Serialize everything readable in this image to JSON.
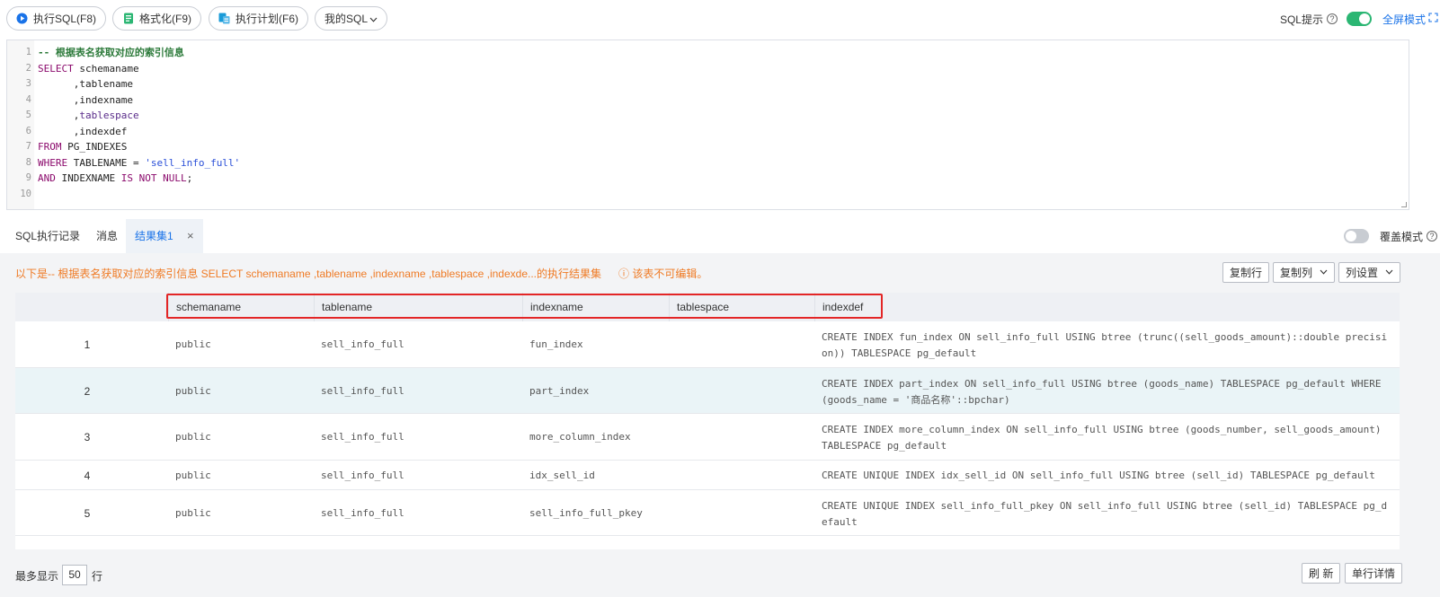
{
  "toolbar": {
    "run_label": "执行SQL(F8)",
    "format_label": "格式化(F9)",
    "plan_label": "执行计划(F6)",
    "mysql_label": "我的SQL",
    "sql_hint_label": "SQL提示",
    "fullscreen_label": "全屏模式",
    "sql_hint_on": true
  },
  "editor": {
    "lines": [
      {
        "n": "1",
        "parts": [
          [
            "cm",
            "-- 根据表名获取对应的索引信息"
          ]
        ]
      },
      {
        "n": "2",
        "parts": [
          [
            "kw",
            "SELECT"
          ],
          [
            "id",
            " schemaname"
          ]
        ]
      },
      {
        "n": "3",
        "parts": [
          [
            "id",
            "      ,tablename"
          ]
        ]
      },
      {
        "n": "4",
        "parts": [
          [
            "id",
            "      ,indexname"
          ]
        ]
      },
      {
        "n": "5",
        "parts": [
          [
            "id",
            "      ,"
          ],
          [
            "tsp",
            "tablespace"
          ]
        ]
      },
      {
        "n": "6",
        "parts": [
          [
            "id",
            "      ,indexdef"
          ]
        ]
      },
      {
        "n": "7",
        "parts": [
          [
            "kw",
            "FROM"
          ],
          [
            "id",
            " PG_INDEXES"
          ]
        ]
      },
      {
        "n": "8",
        "parts": [
          [
            "kw",
            "WHERE"
          ],
          [
            "id",
            " TABLENAME = "
          ],
          [
            "str",
            "'sell_info_full'"
          ]
        ]
      },
      {
        "n": "9",
        "parts": [
          [
            "kw",
            "AND"
          ],
          [
            "id",
            " INDEXNAME "
          ],
          [
            "kw",
            "IS NOT NULL"
          ],
          [
            "id",
            ";"
          ]
        ]
      },
      {
        "n": "10",
        "parts": []
      }
    ]
  },
  "tabs": {
    "history": "SQL执行记录",
    "messages": "消息",
    "result1": "结果集1",
    "close": "×",
    "cover_mode_label": "覆盖模式"
  },
  "result": {
    "info": "以下是-- 根据表名获取对应的索引信息 SELECT schemaname ,tablename ,indexname ,tablespace ,indexde...的执行结果集",
    "readonly_note": "ⓘ 该表不可编辑。",
    "copy_row": "复制行",
    "copy_col": "复制列",
    "col_settings": "列设置",
    "columns": [
      "schemaname",
      "tablename",
      "indexname",
      "tablespace",
      "indexdef"
    ],
    "rows": [
      {
        "num": "1",
        "schemaname": "public",
        "tablename": "sell_info_full",
        "indexname": "fun_index",
        "tablespace": "",
        "indexdef": "CREATE INDEX fun_index ON sell_info_full USING btree (trunc((sell_goods_amount)::double precisi\non)) TABLESPACE pg_default"
      },
      {
        "num": "2",
        "schemaname": "public",
        "tablename": "sell_info_full",
        "indexname": "part_index",
        "tablespace": "",
        "indexdef": "CREATE INDEX part_index ON sell_info_full USING btree (goods_name) TABLESPACE pg_default WHERE\n(goods_name = '商品名称'::bpchar)"
      },
      {
        "num": "3",
        "schemaname": "public",
        "tablename": "sell_info_full",
        "indexname": "more_column_index",
        "tablespace": "",
        "indexdef": "CREATE INDEX more_column_index ON sell_info_full USING btree (goods_number, sell_goods_amount)\nTABLESPACE pg_default"
      },
      {
        "num": "4",
        "schemaname": "public",
        "tablename": "sell_info_full",
        "indexname": "idx_sell_id",
        "tablespace": "",
        "indexdef": "CREATE UNIQUE INDEX idx_sell_id ON sell_info_full USING btree (sell_id) TABLESPACE pg_default"
      },
      {
        "num": "5",
        "schemaname": "public",
        "tablename": "sell_info_full",
        "indexname": "sell_info_full_pkey",
        "tablespace": "",
        "indexdef": "CREATE UNIQUE INDEX sell_info_full_pkey ON sell_info_full USING btree (sell_id) TABLESPACE pg_d\nefault"
      }
    ]
  },
  "footer": {
    "max_label": "最多显示",
    "max_value": "50",
    "unit": "行",
    "refresh": "刷 新",
    "row_detail": "单行详情"
  },
  "colors": {
    "accent": "#1a73e8",
    "toggle_on": "#2bb673",
    "warning": "#ef7a24",
    "highlight_box": "#e32626"
  }
}
